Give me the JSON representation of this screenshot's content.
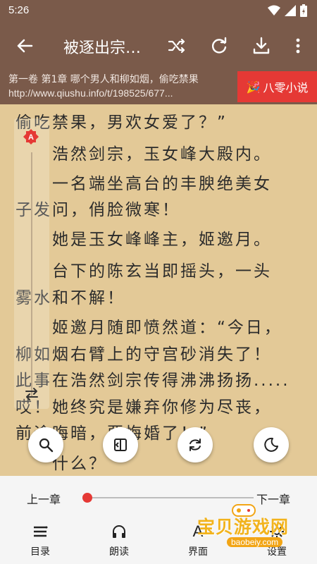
{
  "status": {
    "time": "5:26"
  },
  "toolbar": {
    "title": "被逐出宗门后...",
    "icons": [
      "back-icon",
      "shuffle-icon",
      "refresh-icon",
      "download-icon",
      "more-icon"
    ]
  },
  "urlbar": {
    "chapter": "第一卷 第1章 哪个男人和柳如烟，偷吃禁果",
    "url": "http://www.qiushu.info/t/198525/677...",
    "source": "八零小说"
  },
  "reader": {
    "lines": [
      "偷吃禁果，男欢女爱了？”",
      "　　浩然剑宗，玉女峰大殿内。",
      "　　一名端坐高台的丰腴绝美女",
      "子发问，俏脸微寒！",
      "　　她是玉女峰峰主，姬邀月。",
      "　　台下的陈玄当即摇头，一头",
      "雾水和不解！",
      "　　姬邀月随即愤然道：“今日，",
      "柳如烟右臂上的守宫砂消失了！",
      "此事在浩然剑宗传得沸沸扬扬.....",
      "哎！她终究是嫌弃你修为尽丧，",
      "前途晦暗，要悔婚了！”",
      "　　什么？"
    ]
  },
  "controls": {
    "prev": "上一章",
    "next": "下一章",
    "progress": 0.0,
    "nav": [
      {
        "label": "目录",
        "icon": "menu-list-icon"
      },
      {
        "label": "朗读",
        "icon": "headphones-icon"
      },
      {
        "label": "界面",
        "icon": "font-icon"
      },
      {
        "label": "设置",
        "icon": "settings-icon"
      }
    ]
  },
  "watermark": {
    "text": "宝贝游戏网",
    "url": "baobeiy.com"
  },
  "colors": {
    "toolbar": "#7a5a4a",
    "page": "#e3c997",
    "accent": "#e53935"
  }
}
